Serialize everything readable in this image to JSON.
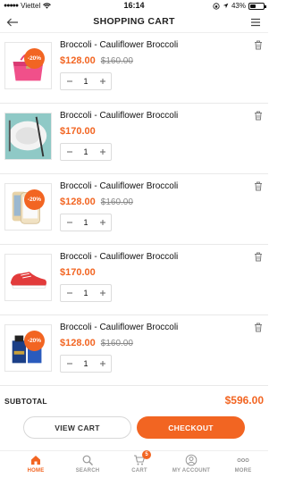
{
  "status_bar": {
    "carrier": "Viettel",
    "time": "16:14",
    "battery": "43%",
    "battery_level": 0.43
  },
  "header": {
    "title": "SHOPPING CART",
    "back_icon": "arrow-left-icon",
    "menu_icon": "hamburger-menu-icon"
  },
  "cart": {
    "items": [
      {
        "name": "Broccoli - Cauliflower Broccoli",
        "price": "$128.00",
        "old_price": "$160.00",
        "quantity": "1",
        "discount": "-20%",
        "image": "handbag"
      },
      {
        "name": "Broccoli - Cauliflower Broccoli",
        "price": "$170.00",
        "old_price": "",
        "quantity": "1",
        "discount": "",
        "image": "plate"
      },
      {
        "name": "Broccoli - Cauliflower Broccoli",
        "price": "$128.00",
        "old_price": "$160.00",
        "quantity": "1",
        "discount": "-20%",
        "image": "phone"
      },
      {
        "name": "Broccoli - Cauliflower Broccoli",
        "price": "$170.00",
        "old_price": "",
        "quantity": "1",
        "discount": "",
        "image": "sneaker"
      },
      {
        "name": "Broccoli - Cauliflower Broccoli",
        "price": "$128.00",
        "old_price": "$160.00",
        "quantity": "1",
        "discount": "-20%",
        "image": "perfume"
      }
    ]
  },
  "summary": {
    "subtotal_label": "SUBTOTAL",
    "subtotal_value": "$596.00"
  },
  "actions": {
    "view_cart": "VIEW CART",
    "checkout": "CHECKOUT"
  },
  "tabs": [
    {
      "label": "HOME",
      "icon": "home-icon",
      "active": true
    },
    {
      "label": "SEARCH",
      "icon": "search-icon",
      "active": false
    },
    {
      "label": "CART",
      "icon": "cart-icon",
      "active": false,
      "badge": "5"
    },
    {
      "label": "MY ACCOUNT",
      "icon": "account-icon",
      "active": false
    },
    {
      "label": "MORE",
      "icon": "more-icon",
      "active": false
    }
  ],
  "colors": {
    "accent": "#f26522",
    "text": "#222222",
    "muted": "#888888"
  }
}
